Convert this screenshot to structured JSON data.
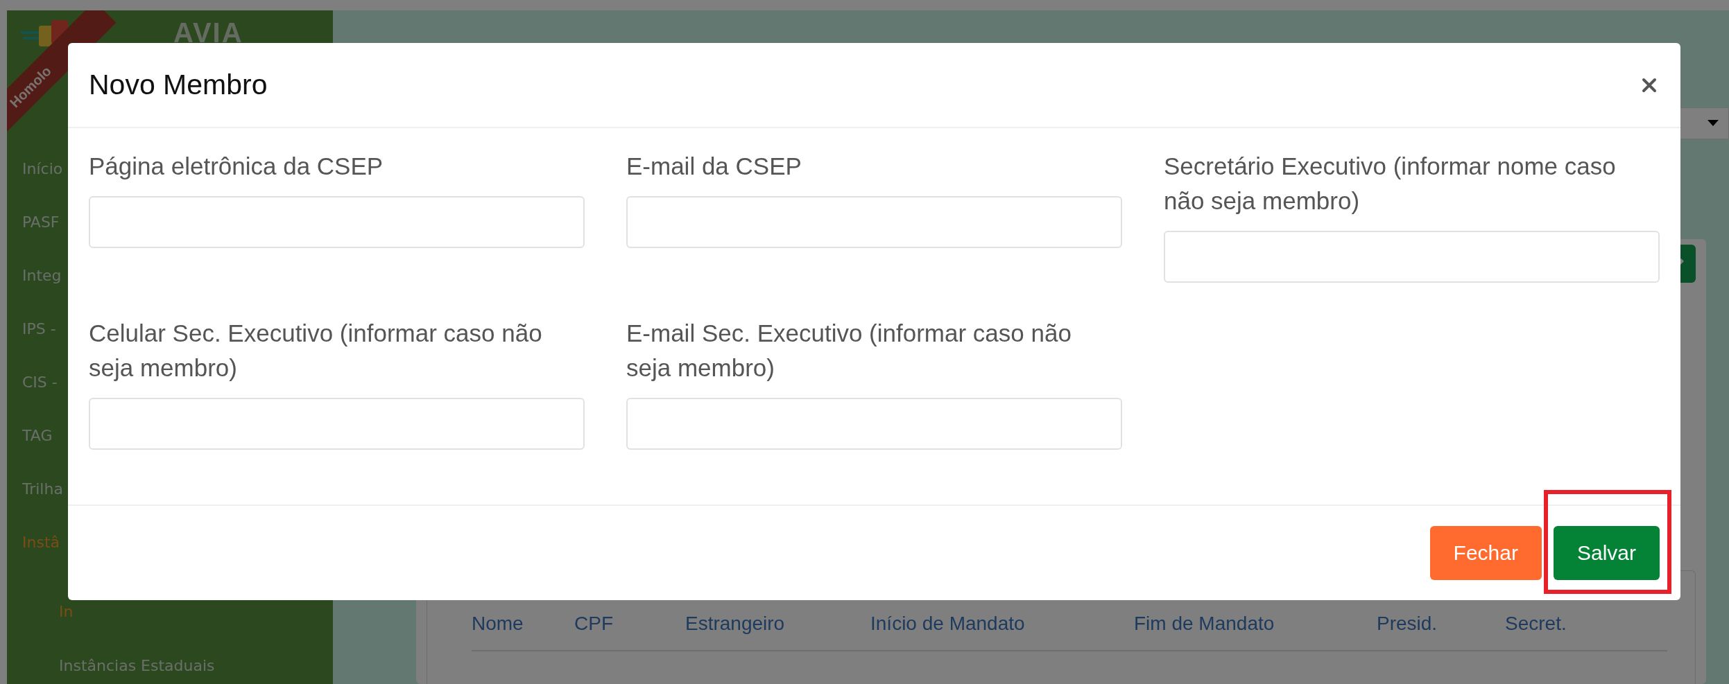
{
  "sidebar": {
    "logo_text": "AVIA",
    "ribbon": "Homolo",
    "items": [
      {
        "label": "Início",
        "selected": false
      },
      {
        "label": "PASF",
        "selected": false
      },
      {
        "label": "Integ",
        "selected": false
      },
      {
        "label": "IPS -",
        "selected": false
      },
      {
        "label": "CIS -",
        "selected": false
      },
      {
        "label": "TAG",
        "selected": false
      },
      {
        "label": "Trilha",
        "selected": false
      },
      {
        "label": "Instâ",
        "selected": true,
        "children": [
          {
            "label": "In",
            "selected": true
          },
          {
            "label": "Instâncias Estaduais",
            "selected": false
          }
        ]
      }
    ]
  },
  "table": {
    "columns": [
      "Nome",
      "CPF",
      "Estrangeiro",
      "Início de Mandato",
      "Fim de Mandato",
      "Presid.",
      "Secret."
    ]
  },
  "modal": {
    "title": "Novo Membro",
    "fields": [
      {
        "label": "Página eletrônica da CSEP"
      },
      {
        "label": "E-mail da CSEP"
      },
      {
        "label": "Secretário Executivo (informar nome caso não seja membro)"
      },
      {
        "label": "Celular Sec. Executivo (informar caso não seja membro)"
      },
      {
        "label": "E-mail Sec. Executivo (informar caso não seja membro)"
      }
    ],
    "buttons": [
      {
        "label": "Fechar",
        "kind": "secondary",
        "highlighted": false
      },
      {
        "label": "Salvar",
        "kind": "primary",
        "highlighted": true
      }
    ]
  }
}
